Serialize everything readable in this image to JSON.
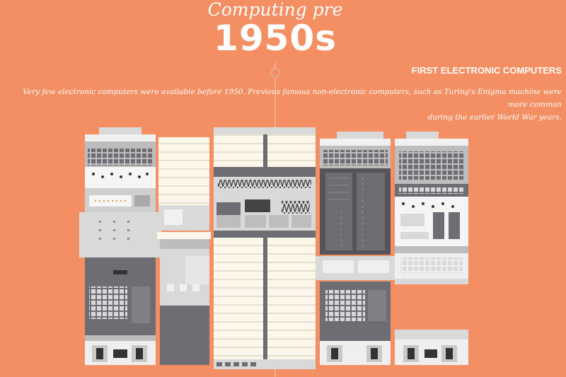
{
  "header": {
    "title_line1": "Computing pre",
    "title_line2": "1950s"
  },
  "section": {
    "heading": "FIRST ELECTRONIC COMPUTERS",
    "description_line1": "Very few electronic computers were available before 1950. Previous famous non-electronic computers, such as Turing's Enigma machine were more common",
    "description_line2": "during the earlier World War years."
  },
  "colors": {
    "background": "#f38f63",
    "panel_light": "#d9d9d9",
    "panel_dark": "#6e6d73",
    "panel_cream": "#fbf7ea"
  },
  "icons": {
    "timeline_marker": "circle-dot-icon"
  }
}
